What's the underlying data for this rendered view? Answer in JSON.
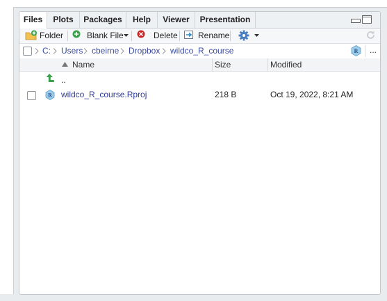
{
  "tabs": [
    {
      "label": "Files",
      "active": true
    },
    {
      "label": "Plots",
      "active": false
    },
    {
      "label": "Packages",
      "active": false
    },
    {
      "label": "Help",
      "active": false
    },
    {
      "label": "Viewer",
      "active": false
    },
    {
      "label": "Presentation",
      "active": false
    }
  ],
  "toolbar": {
    "new_folder_label": "Folder",
    "blank_file_label": "Blank File",
    "delete_label": "Delete",
    "rename_label": "Rename"
  },
  "breadcrumb": [
    "C:",
    "Users",
    "cbeirne",
    "Dropbox",
    "wildco_R_course"
  ],
  "columns": {
    "name": "Name",
    "size": "Size",
    "modified": "Modified"
  },
  "parent_dir_label": "..",
  "files": [
    {
      "name": "wildco_R_course.Rproj",
      "size": "218 B",
      "modified": "Oct 19, 2022, 8:21 AM",
      "icon": "rproj-icon"
    }
  ],
  "more_label": "...",
  "colors": {
    "link": "#2c3a9c",
    "accent_green": "#3aa14a",
    "accent_red": "#c62828",
    "accent_blue": "#4a7fc1"
  }
}
